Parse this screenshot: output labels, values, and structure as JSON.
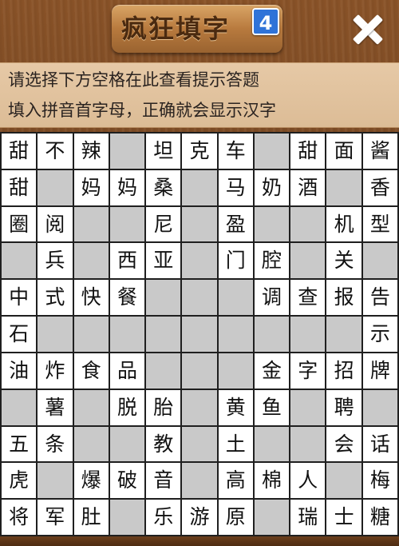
{
  "header": {
    "title": "疯狂填字",
    "level": "4",
    "close_icon": "close-icon"
  },
  "hints": {
    "line1": "请选择下方空格在此查看提示答题",
    "line2": "填入拼音首字母，正确就会显示汉字"
  },
  "grid": {
    "rows": 11,
    "cols": 11,
    "cells": [
      [
        "甜",
        "不",
        "辣",
        null,
        "坦",
        "克",
        "车",
        null,
        "甜",
        "面",
        "酱"
      ],
      [
        "甜",
        "",
        "妈",
        "妈",
        "桑",
        "",
        "马",
        "奶",
        "酒",
        "",
        "香"
      ],
      [
        "圈",
        "阅",
        "",
        "",
        "尼",
        "",
        "盈",
        "",
        "",
        "机",
        "型"
      ],
      [
        "",
        "兵",
        "",
        "西",
        "亚",
        "",
        "门",
        "腔",
        "",
        "关",
        ""
      ],
      [
        "中",
        "式",
        "快",
        "餐",
        "",
        "",
        "",
        "调",
        "查",
        "报",
        "告"
      ],
      [
        "石",
        "",
        "",
        "",
        "",
        "",
        "",
        "",
        "",
        "",
        "示"
      ],
      [
        "油",
        "炸",
        "食",
        "品",
        "",
        "",
        "",
        "金",
        "字",
        "招",
        "牌"
      ],
      [
        "",
        "薯",
        "",
        "脱",
        "胎",
        "",
        "黄",
        "鱼",
        "",
        "聘",
        ""
      ],
      [
        "五",
        "条",
        "",
        "",
        "教",
        "",
        "土",
        "",
        "",
        "会",
        "话"
      ],
      [
        "虎",
        "",
        "爆",
        "破",
        "音",
        "",
        "高",
        "棉",
        "人",
        "",
        "梅"
      ],
      [
        "将",
        "军",
        "肚",
        "",
        "乐",
        "游",
        "原",
        "",
        "瑞",
        "士",
        "糖"
      ]
    ],
    "white_mask": [
      [
        1,
        1,
        1,
        0,
        1,
        1,
        1,
        0,
        1,
        1,
        1
      ],
      [
        1,
        0,
        1,
        1,
        1,
        0,
        1,
        1,
        1,
        0,
        1
      ],
      [
        1,
        1,
        0,
        0,
        1,
        0,
        1,
        0,
        0,
        1,
        1
      ],
      [
        0,
        1,
        0,
        1,
        1,
        0,
        1,
        1,
        0,
        1,
        0
      ],
      [
        1,
        1,
        1,
        1,
        0,
        0,
        0,
        1,
        1,
        1,
        1
      ],
      [
        1,
        0,
        0,
        0,
        0,
        0,
        0,
        0,
        0,
        0,
        1
      ],
      [
        1,
        1,
        1,
        1,
        0,
        0,
        0,
        1,
        1,
        1,
        1
      ],
      [
        0,
        1,
        0,
        1,
        1,
        0,
        1,
        1,
        0,
        1,
        0
      ],
      [
        1,
        1,
        0,
        0,
        1,
        0,
        1,
        0,
        0,
        1,
        1
      ],
      [
        1,
        0,
        1,
        1,
        1,
        0,
        1,
        1,
        1,
        0,
        1
      ],
      [
        1,
        1,
        1,
        0,
        1,
        1,
        1,
        0,
        1,
        1,
        1
      ]
    ]
  },
  "colors": {
    "wood": "#7a4a22",
    "hint_bg": "#e6c9a6",
    "cell_white": "#ffffff",
    "cell_gray": "#c9c9c9",
    "grid_line": "#1f1f1f",
    "badge": "#2f73d8"
  }
}
